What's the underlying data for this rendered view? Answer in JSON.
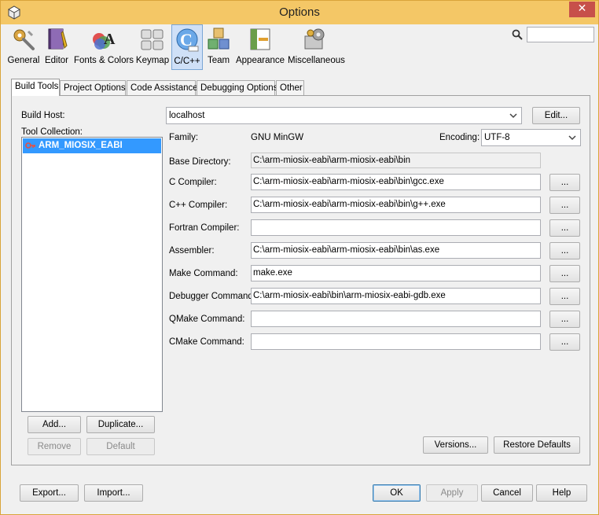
{
  "window": {
    "title": "Options",
    "close_glyph": "✕"
  },
  "categories": [
    {
      "label": "General",
      "icon": "general-icon"
    },
    {
      "label": "Editor",
      "icon": "editor-icon"
    },
    {
      "label": "Fonts & Colors",
      "icon": "fonts-colors-icon"
    },
    {
      "label": "Keymap",
      "icon": "keymap-icon"
    },
    {
      "label": "C/C++",
      "icon": "cpp-icon",
      "selected": true
    },
    {
      "label": "Team",
      "icon": "team-icon"
    },
    {
      "label": "Appearance",
      "icon": "appearance-icon"
    },
    {
      "label": "Miscellaneous",
      "icon": "miscellaneous-icon"
    }
  ],
  "search": {
    "value": ""
  },
  "tabs": [
    {
      "label": "Build Tools",
      "active": true
    },
    {
      "label": "Project Options"
    },
    {
      "label": "Code Assistance"
    },
    {
      "label": "Debugging Options"
    },
    {
      "label": "Other"
    }
  ],
  "build_tools": {
    "build_host_label": "Build Host:",
    "build_host_value": "localhost",
    "edit_button": "Edit...",
    "tool_collection_label": "Tool Collection:",
    "tool_collections": [
      "ARM_MIOSIX_EABI"
    ],
    "family_label": "Family:",
    "family_value": "GNU MinGW",
    "encoding_label": "Encoding:",
    "encoding_value": "UTF-8",
    "base_dir_label": "Base Directory:",
    "base_dir_value": "C:\\arm-miosix-eabi\\arm-miosix-eabi\\bin",
    "browse_label": "...",
    "fields": [
      {
        "label": "C Compiler:",
        "value": "C:\\arm-miosix-eabi\\arm-miosix-eabi\\bin\\gcc.exe"
      },
      {
        "label": "C++ Compiler:",
        "value": "C:\\arm-miosix-eabi\\arm-miosix-eabi\\bin\\g++.exe"
      },
      {
        "label": "Fortran Compiler:",
        "value": ""
      },
      {
        "label": "Assembler:",
        "value": "C:\\arm-miosix-eabi\\arm-miosix-eabi\\bin\\as.exe"
      },
      {
        "label": "Make Command:",
        "value": "make.exe"
      },
      {
        "label": "Debugger Command:",
        "value": "C:\\arm-miosix-eabi\\bin\\arm-miosix-eabi-gdb.exe"
      },
      {
        "label": "QMake Command:",
        "value": ""
      },
      {
        "label": "CMake Command:",
        "value": ""
      }
    ],
    "add_button": "Add...",
    "duplicate_button": "Duplicate...",
    "remove_button": "Remove",
    "default_button": "Default",
    "versions_button": "Versions...",
    "restore_defaults_button": "Restore Defaults"
  },
  "footer": {
    "export_button": "Export...",
    "import_button": "Import...",
    "ok_button": "OK",
    "apply_button": "Apply",
    "cancel_button": "Cancel",
    "help_button": "Help"
  },
  "colors": {
    "titlebar": "#f4c766",
    "selection": "#3399ff",
    "close_button": "#c7504a"
  }
}
